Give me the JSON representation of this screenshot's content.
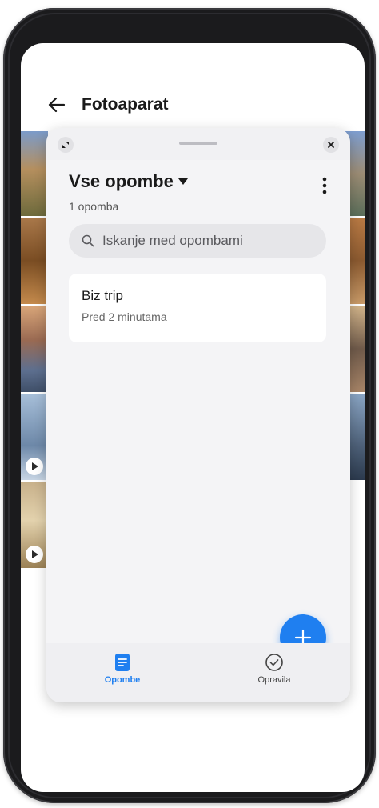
{
  "header": {
    "title": "Fotoaparat",
    "back_icon": "arrow-left-icon"
  },
  "panel": {
    "resize_icon": "resize-icon",
    "close_icon": "close-icon",
    "title": "Vse opombe",
    "count": "1 opomba",
    "more_icon": "more-vertical-icon",
    "search": {
      "placeholder": "Iskanje med opombami",
      "icon": "search-icon"
    },
    "notes": [
      {
        "title": "Biz trip",
        "time": "Pred 2 minutama"
      }
    ],
    "fab_icon": "plus-icon",
    "nav": [
      {
        "label": "Opombe",
        "icon": "note-icon",
        "active": true
      },
      {
        "label": "Opravila",
        "icon": "check-circle-icon",
        "active": false
      }
    ]
  },
  "colors": {
    "accent": "#1f7ff0",
    "panel_bg": "#f4f4f6",
    "card_bg": "#ffffff",
    "text_primary": "#1a1a1a"
  }
}
